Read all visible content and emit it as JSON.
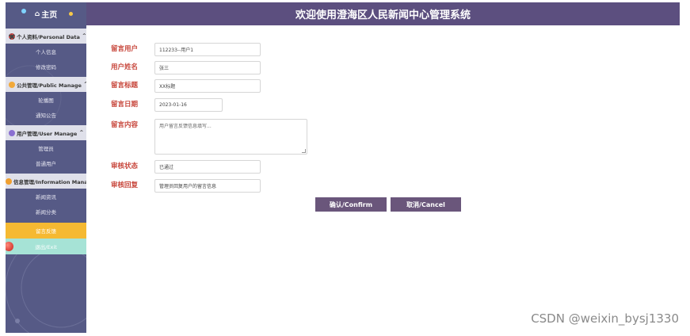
{
  "sidebar": {
    "home_label": "主页",
    "groups": [
      {
        "label": "个人资料/Personal Data",
        "items": [
          "个人信息",
          "修改密码"
        ]
      },
      {
        "label": "公共管理/Public Manage",
        "items": [
          "轮播图",
          "通知公告"
        ]
      },
      {
        "label": "用户管理/User Manage",
        "items": [
          "管理员",
          "普通用户"
        ]
      },
      {
        "label": "信息管理/Information Manage",
        "items": [
          "新闻资讯",
          "新闻分类",
          "留言反馈"
        ]
      }
    ],
    "exit_label": "退出/Exit"
  },
  "header": {
    "title": "欢迎使用澄海区人民新闻中心管理系统"
  },
  "form": {
    "user_label": "留言用户",
    "user_value": "112233--用户1",
    "name_label": "用户姓名",
    "name_value": "张三",
    "title_label": "留言标题",
    "title_value": "XX标题",
    "date_label": "留言日期",
    "date_value": "2023-01-16",
    "content_label": "留言内容",
    "content_value": "用户留言反馈信息填写...",
    "status_label": "审核状态",
    "status_value": "已通过",
    "reply_label": "审核回复",
    "reply_value": "管理员回复用户的留言信息"
  },
  "buttons": {
    "confirm": "确认/Confirm",
    "cancel": "取消/Cancel"
  },
  "watermark": "CSDN @weixin_bysj1330",
  "colors": {
    "sidebar": "#565a86",
    "header": "#5c4f7f",
    "label": "#c7453a",
    "active": "#f5b932",
    "exit": "#a6e3d6",
    "button": "#6a567b"
  }
}
